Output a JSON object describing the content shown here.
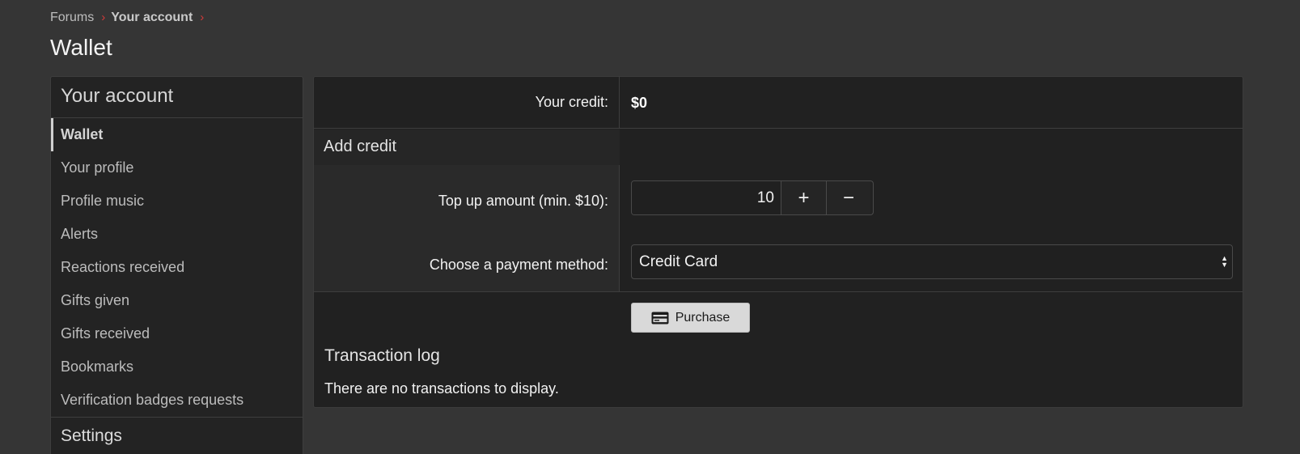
{
  "breadcrumb": {
    "items": [
      "Forums",
      "Your account"
    ],
    "separator": "›"
  },
  "page": {
    "title": "Wallet"
  },
  "sidebar": {
    "heading": "Your account",
    "items": [
      {
        "label": "Wallet",
        "active": true
      },
      {
        "label": "Your profile"
      },
      {
        "label": "Profile music"
      },
      {
        "label": "Alerts"
      },
      {
        "label": "Reactions received"
      },
      {
        "label": "Gifts given"
      },
      {
        "label": "Gifts received"
      },
      {
        "label": "Bookmarks"
      },
      {
        "label": "Verification badges requests"
      }
    ],
    "settings_heading": "Settings"
  },
  "wallet": {
    "credit_label": "Your credit:",
    "credit_value": "$0",
    "add_credit_heading": "Add credit",
    "topup_label": "Top up amount (min. $10):",
    "topup_value": "10",
    "plus_label": "+",
    "minus_label": "−",
    "payment_label": "Choose a payment method:",
    "payment_selected": "Credit Card",
    "purchase_label": "Purchase",
    "txlog_heading": "Transaction log",
    "txlog_empty": "There are no transactions to display."
  },
  "colors": {
    "background": "#353535",
    "panel": "#212121",
    "accent_separator": "#d23a3a",
    "button": "#d9d9d9"
  },
  "icons": {
    "purchase": "credit-card-icon",
    "breadcrumb_separator": "chevron-right-icon",
    "select": "select-arrows-icon"
  }
}
